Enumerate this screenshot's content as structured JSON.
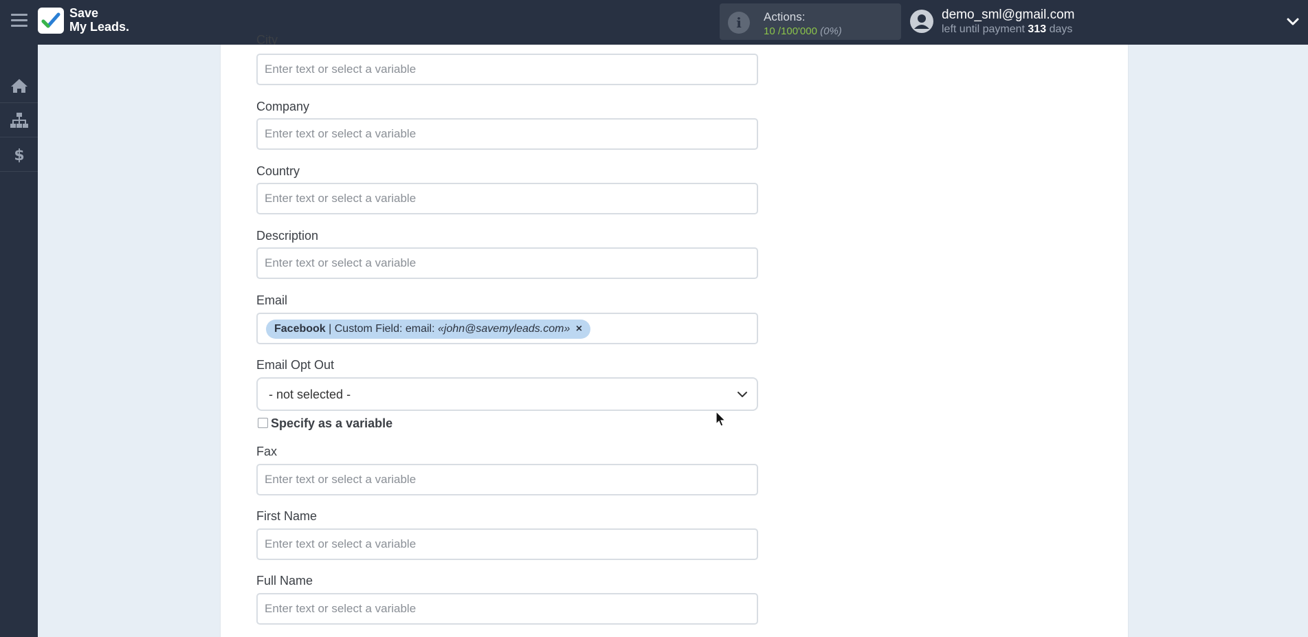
{
  "header": {
    "logo_line1": "Save",
    "logo_line2": "My Leads.",
    "actions_label": "Actions:",
    "actions_used": "10",
    "actions_total": "/100'000",
    "actions_percent": "(0%)",
    "user_email": "demo_sml@gmail.com",
    "payment_prefix": "left until payment",
    "payment_days": "313",
    "payment_suffix": "days"
  },
  "sidebar": {
    "items": [
      {
        "icon": "home-icon"
      },
      {
        "icon": "sitemap-icon"
      },
      {
        "icon": "dollar-icon"
      }
    ]
  },
  "form": {
    "placeholder": "Enter text or select a variable",
    "city_label": "City",
    "company_label": "Company",
    "country_label": "Country",
    "description_label": "Description",
    "email_label": "Email",
    "email_tag": {
      "source": "Facebook",
      "field": " | Custom Field: email: ",
      "value": "«john@savemyleads.com»",
      "close": "×"
    },
    "email_opt_out_label": "Email Opt Out",
    "email_opt_out_value": "- not selected -",
    "specify_variable_label": "Specify as a variable",
    "fax_label": "Fax",
    "first_name_label": "First Name",
    "full_name_label": "Full Name"
  },
  "colors": {
    "topbar": "#283142",
    "accent_green": "#8bc34a",
    "tag_bg": "#bcd7f1"
  }
}
